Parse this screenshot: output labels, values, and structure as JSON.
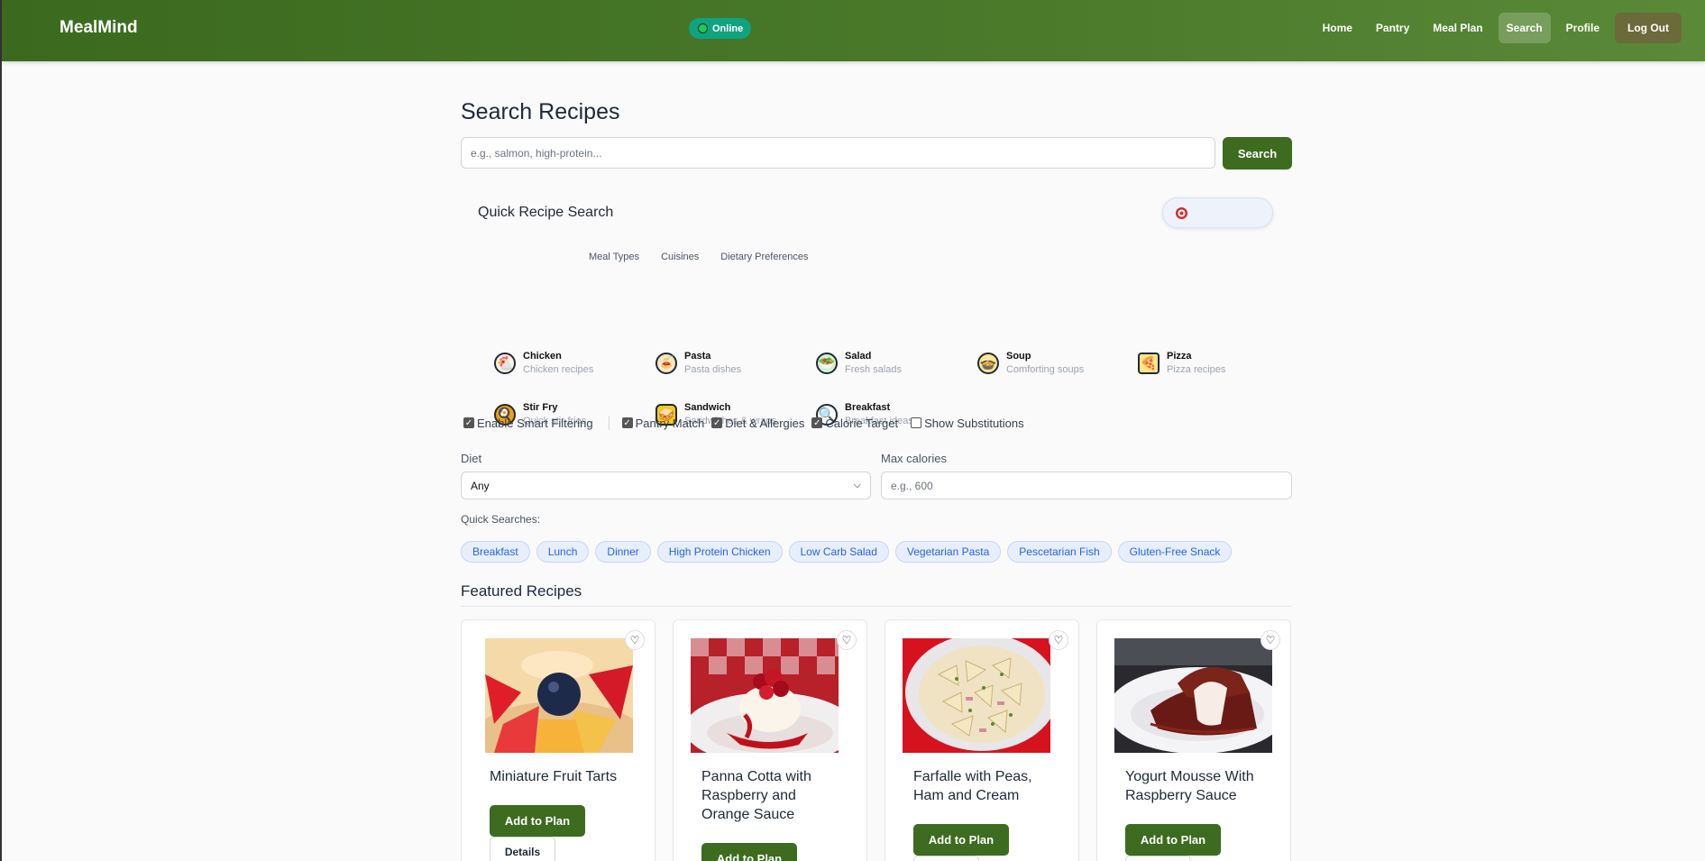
{
  "header": {
    "brand": "MealMind",
    "status": "Online",
    "nav": [
      "Home",
      "Pantry",
      "Meal Plan",
      "Search",
      "Profile",
      "Log Out"
    ]
  },
  "search": {
    "title": "Search Recipes",
    "placeholder": "e.g., salmon, high-protein...",
    "button": "Search"
  },
  "quick": {
    "title": "Quick Recipe Search",
    "ai_button_icon": "target-icon",
    "tabs": [
      "Meal Types",
      "Cuisines",
      "Dietary Preferences"
    ],
    "categories": [
      {
        "name": "Chicken",
        "sub": "Chicken recipes",
        "icon": "chicken-icon"
      },
      {
        "name": "Pasta",
        "sub": "Pasta dishes",
        "icon": "pasta-icon"
      },
      {
        "name": "Salad",
        "sub": "Fresh salads",
        "icon": "salad-icon"
      },
      {
        "name": "Soup",
        "sub": "Comforting soups",
        "icon": "soup-icon"
      },
      {
        "name": "Pizza",
        "sub": "Pizza recipes",
        "icon": "pizza-icon"
      },
      {
        "name": "Stir Fry",
        "sub": "Quick stir-fries",
        "icon": "stir-fry-icon"
      },
      {
        "name": "Sandwich",
        "sub": "Sandwiches & wraps",
        "icon": "sandwich-icon"
      },
      {
        "name": "Breakfast",
        "sub": "Breakfast ideas",
        "icon": "search-icon"
      }
    ]
  },
  "filters": {
    "smart": {
      "label": "Enable Smart Filtering",
      "checked": true
    },
    "options": [
      {
        "label": "Pantry Match",
        "checked": true
      },
      {
        "label": "Diet & Allergies",
        "checked": true
      },
      {
        "label": "Calorie Target",
        "checked": true
      },
      {
        "label": "Show Substitutions",
        "checked": false
      }
    ],
    "diet_label": "Diet",
    "diet_value": "Any",
    "calories_label": "Max calories",
    "calories_placeholder": "e.g., 600"
  },
  "quick_searches": {
    "label": "Quick Searches:",
    "chips": [
      "Breakfast",
      "Lunch",
      "Dinner",
      "High Protein Chicken",
      "Low Carb Salad",
      "Vegetarian Pasta",
      "Pescetarian Fish",
      "Gluten-Free Snack"
    ]
  },
  "featured": {
    "title": "Featured Recipes",
    "add_label": "Add to Plan",
    "details_label": "Details",
    "recipes": [
      {
        "title": "Miniature Fruit Tarts"
      },
      {
        "title": "Panna Cotta with Raspberry and Orange Sauce"
      },
      {
        "title": "Farfalle with Peas, Ham and Cream"
      },
      {
        "title": "Yogurt Mousse With Raspberry Sauce"
      }
    ]
  }
}
